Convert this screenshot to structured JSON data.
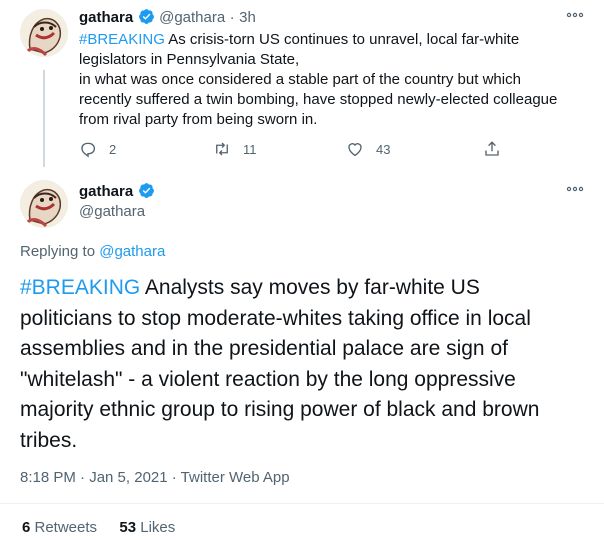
{
  "tweet1": {
    "name": "gathara",
    "handle": "@gathara",
    "sep": "·",
    "time": "3h",
    "hashtag": "#BREAKING",
    "text_line1": " As crisis-torn US continues to unravel, local far-white",
    "text_line2": "legislators in Pennsylvania State,",
    "text_line3": "in what was once considered a stable part of the country but which",
    "text_line4": "recently suffered a twin bombing, have stopped newly-elected colleague",
    "text_line5": "from rival party from being sworn in.",
    "replies": "2",
    "retweets": "11",
    "likes": "43"
  },
  "tweet2": {
    "name": "gathara",
    "handle": "@gathara",
    "replying_prefix": "Replying to ",
    "replying_handle": "@gathara",
    "hashtag": "#BREAKING",
    "line1": " Analysts say moves by far-white US",
    "line2": "politicians to stop moderate-whites taking office in local",
    "line3": "assemblies and in the presidential palace are sign of",
    "line4": "\"whitelash\" - a violent reaction by the long oppressive",
    "line5": "majority ethnic group to rising power of black and brown",
    "line6": "tribes.",
    "timestamp": "8:18 PM · Jan 5, 2021 · ",
    "source": "Twitter Web App",
    "retweet_count": "6",
    "retweet_label": " Retweets",
    "like_count": "53",
    "like_label": " Likes"
  },
  "icons": {
    "more": "more-icon",
    "verified": "verified-badge-icon",
    "reply": "reply-icon",
    "retweet": "retweet-icon",
    "like": "like-icon",
    "share": "share-icon"
  },
  "colors": {
    "accent": "#1d9bf0",
    "muted": "#536471",
    "text": "#0f1419"
  }
}
